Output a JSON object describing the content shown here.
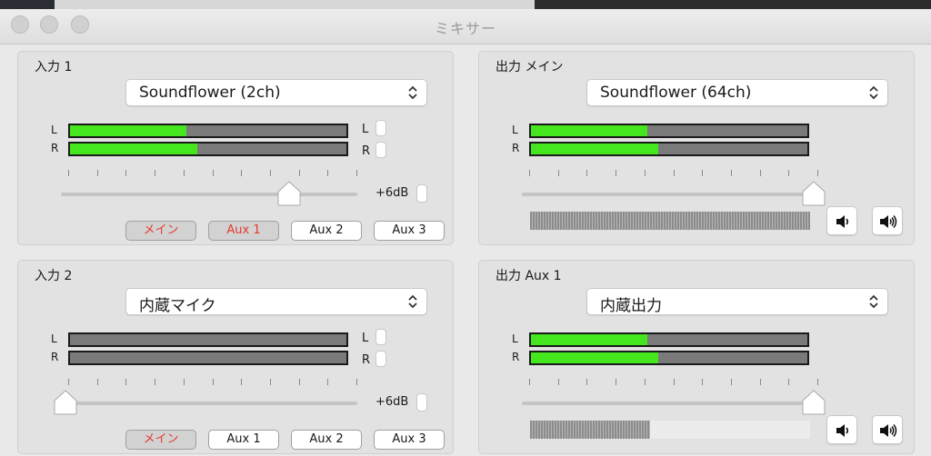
{
  "window": {
    "title": "ミキサー"
  },
  "inputs": [
    {
      "title": "入力 1",
      "device": "Soundflower (2ch)",
      "meters": [
        {
          "label": "L",
          "side": "L",
          "level": 0.42
        },
        {
          "label": "R",
          "side": "R",
          "level": 0.46
        }
      ],
      "gain_position": 0.78,
      "gain_label": "+6dB",
      "routes": [
        {
          "label": "メイン",
          "active": true
        },
        {
          "label": "Aux 1",
          "active": true
        },
        {
          "label": "Aux 2",
          "active": false
        },
        {
          "label": "Aux 3",
          "active": false
        }
      ]
    },
    {
      "title": "入力 2",
      "device": "内蔵マイク",
      "meters": [
        {
          "label": "L",
          "side": "L",
          "level": 0
        },
        {
          "label": "R",
          "side": "R",
          "level": 0
        }
      ],
      "gain_position": 0.0,
      "gain_label": "+6dB",
      "routes": [
        {
          "label": "メイン",
          "active": true
        },
        {
          "label": "Aux 1",
          "active": false
        },
        {
          "label": "Aux 2",
          "active": false
        },
        {
          "label": "Aux 3",
          "active": false
        }
      ]
    }
  ],
  "outputs": [
    {
      "title": "出力 メイン",
      "device": "Soundflower (64ch)",
      "meters": [
        {
          "label": "L",
          "level": 0.42
        },
        {
          "label": "R",
          "level": 0.46
        }
      ],
      "volume_position": 1.0,
      "level_fraction": 1.0,
      "icons": [
        "speaker-low-icon",
        "speaker-high-icon"
      ]
    },
    {
      "title": "出力 Aux 1",
      "device": "内蔵出力",
      "meters": [
        {
          "label": "L",
          "level": 0.42
        },
        {
          "label": "R",
          "level": 0.46
        }
      ],
      "volume_position": 1.0,
      "level_fraction": 0.43,
      "icons": [
        "speaker-low-icon",
        "speaker-high-icon"
      ]
    }
  ],
  "colors": {
    "meter_green": "#46e61f",
    "route_active_text": "#e53a2e",
    "traffic_light": "#d0d0d0"
  }
}
